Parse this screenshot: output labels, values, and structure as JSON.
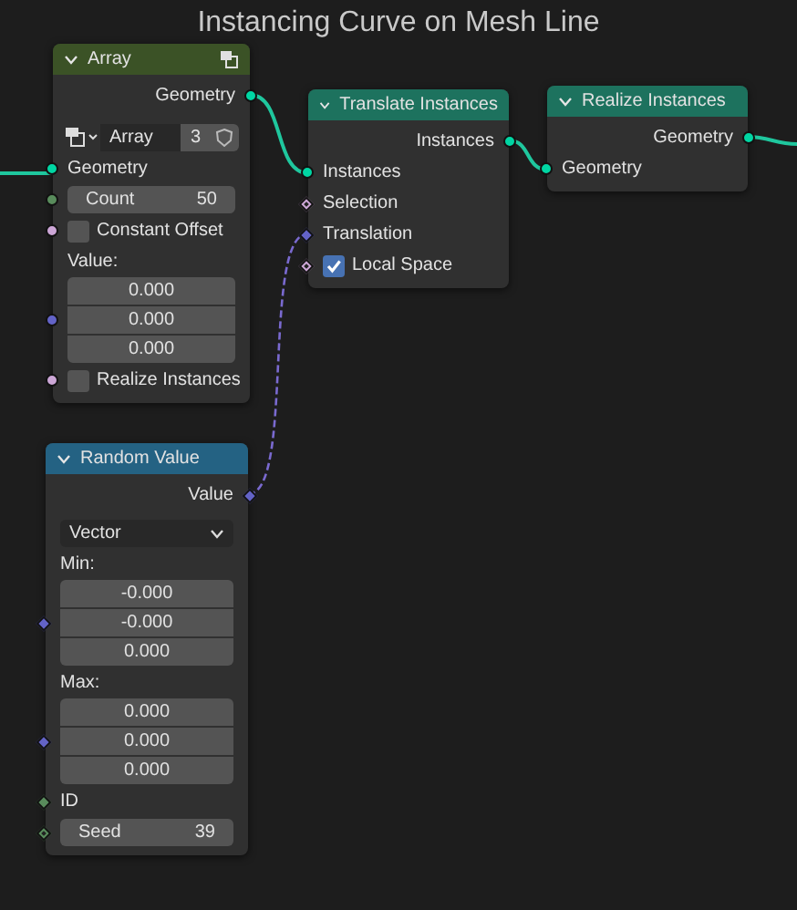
{
  "title": "Instancing Curve on Mesh Line",
  "nodes": [
    {
      "title": "Array",
      "color": "#3b5226",
      "header_icon": true,
      "rows": [
        {
          "kind": "output",
          "label": "Geometry",
          "socket": {
            "color": "#00d6a3",
            "kind": "circle"
          }
        },
        {
          "kind": "datablock",
          "label": "Array",
          "users": "3"
        },
        {
          "kind": "input",
          "label": "Geometry",
          "socket": {
            "color": "#00d6a3",
            "kind": "circle"
          }
        },
        {
          "kind": "field",
          "label": "Count",
          "value": "50",
          "socket": {
            "color": "#598c5c",
            "kind": "circle"
          }
        },
        {
          "kind": "checkbox",
          "label": "Constant Offset",
          "checked": false,
          "socket": {
            "color": "#cca6d6",
            "kind": "circle"
          }
        },
        {
          "kind": "label",
          "label": "Value:"
        },
        {
          "kind": "vector",
          "values": [
            "0.000",
            "0.000",
            "0.000"
          ],
          "socket": {
            "color": "#6363c7",
            "kind": "circle"
          }
        },
        {
          "kind": "checkbox",
          "label": "Realize Instances",
          "checked": false,
          "socket": {
            "color": "#cca6d6",
            "kind": "circle"
          }
        }
      ]
    },
    {
      "title": "Translate Instances",
      "color": "#1d725e",
      "header_icon": false,
      "rows": [
        {
          "kind": "output",
          "label": "Instances",
          "socket": {
            "color": "#00d6a3",
            "kind": "circle"
          }
        },
        {
          "kind": "input",
          "label": "Instances",
          "socket": {
            "color": "#00d6a3",
            "kind": "circle"
          }
        },
        {
          "kind": "input",
          "label": "Selection",
          "socket": {
            "color": "#cca6d6",
            "kind": "dotted"
          }
        },
        {
          "kind": "input",
          "label": "Translation",
          "socket": {
            "color": "#6363c7",
            "kind": "diamond"
          }
        },
        {
          "kind": "checkbox",
          "label": "Local Space",
          "checked": true,
          "socket": {
            "color": "#cca6d6",
            "kind": "dotted"
          }
        }
      ]
    },
    {
      "title": "Realize Instances",
      "color": "#1d725e",
      "header_icon": false,
      "rows": [
        {
          "kind": "output",
          "label": "Geometry",
          "socket": {
            "color": "#00d6a3",
            "kind": "circle"
          }
        },
        {
          "kind": "input",
          "label": "Geometry",
          "socket": {
            "color": "#00d6a3",
            "kind": "circle"
          }
        }
      ]
    },
    {
      "title": "Random Value",
      "color": "#246283",
      "header_icon": false,
      "rows": [
        {
          "kind": "output",
          "label": "Value",
          "socket": {
            "color": "#6363c7",
            "kind": "diamond"
          }
        },
        {
          "kind": "dropdown",
          "value": "Vector"
        },
        {
          "kind": "label",
          "label": "Min:"
        },
        {
          "kind": "vector",
          "values": [
            "-0.000",
            "-0.000",
            "0.000"
          ],
          "socket": {
            "color": "#6363c7",
            "kind": "diamond"
          }
        },
        {
          "kind": "label",
          "label": "Max:"
        },
        {
          "kind": "vector",
          "values": [
            "0.000",
            "0.000",
            "0.000"
          ],
          "socket": {
            "color": "#6363c7",
            "kind": "diamond"
          }
        },
        {
          "kind": "input",
          "label": "ID",
          "socket": {
            "color": "#598c5c",
            "kind": "diamond"
          }
        },
        {
          "kind": "field",
          "label": "Seed",
          "value": "39",
          "socket": {
            "color": "#598c5c",
            "kind": "dotted"
          }
        }
      ]
    }
  ]
}
